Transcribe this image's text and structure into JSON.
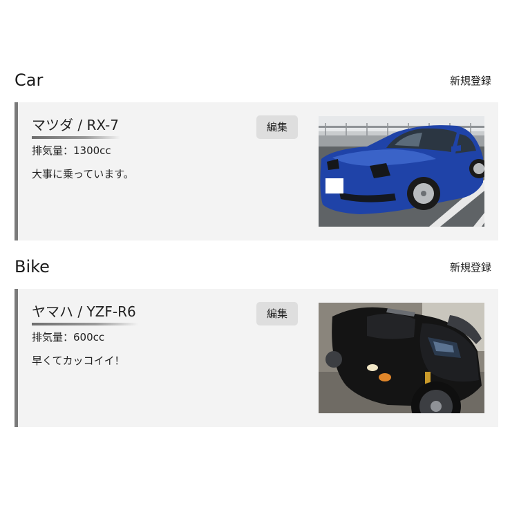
{
  "sections": [
    {
      "title": "Car",
      "new_label": "新規登録",
      "item": {
        "name": "マツダ / RX-7",
        "spec": "排気量：1300cc",
        "description": "大事に乗っています。",
        "edit_label": "編集",
        "photo_icon": "car-photo"
      }
    },
    {
      "title": "Bike",
      "new_label": "新規登録",
      "item": {
        "name": "ヤマハ / YZF-R6",
        "spec": "排気量：600cc",
        "description": "早くてカッコイイ！",
        "edit_label": "編集",
        "photo_icon": "motorcycle-photo"
      }
    }
  ],
  "colors": {
    "card_background": "#f3f3f3",
    "card_border": "#7a7a7a",
    "button_background": "#dedede",
    "car_blue": "#1f43a8"
  }
}
